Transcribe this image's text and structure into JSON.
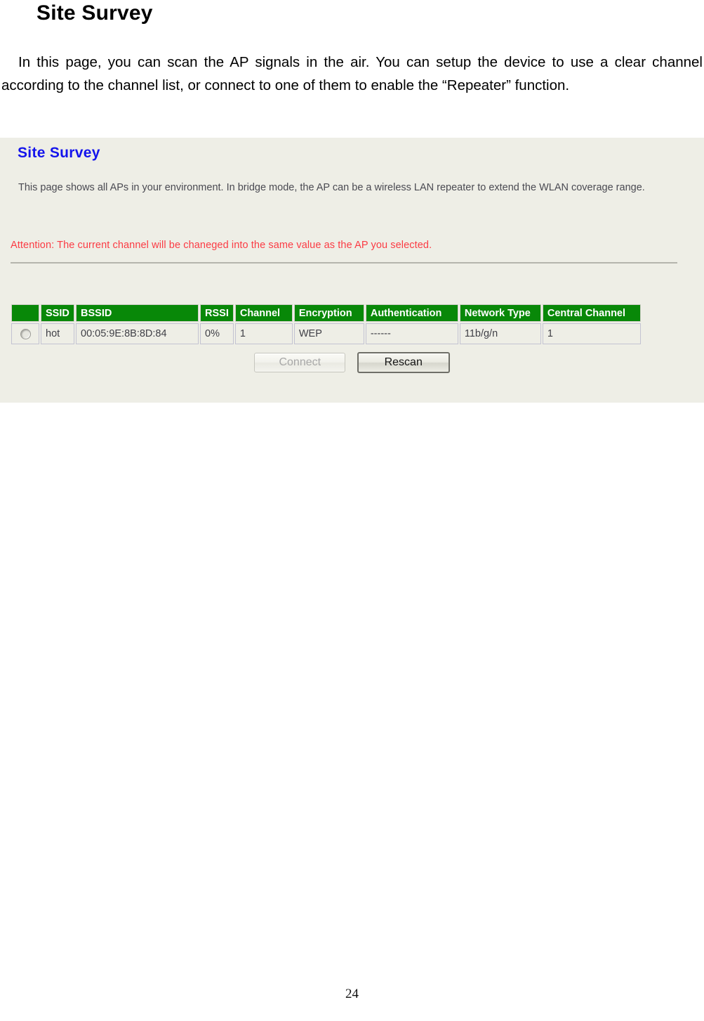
{
  "document": {
    "heading": "Site Survey",
    "paragraph": "In this page, you can scan the AP signals in the air. You can setup the device to use a clear channel according to the channel list, or connect to one of them to enable the “Repeater” function.",
    "page_number": "24"
  },
  "screenshot": {
    "title": "Site Survey",
    "description": "This page shows all APs in your environment. In bridge mode, the AP can be a wireless LAN repeater to extend the WLAN coverage range.",
    "attention": "Attention: The current channel will be chaneged into the same value as the AP you selected.",
    "colors": {
      "panel_background": "#EEEEE6",
      "title_blue": "#1414EC",
      "attention_red": "#FB3B44",
      "table_header_green": "#088808",
      "divider_gray": "#B5B5AD"
    },
    "table": {
      "headers": [
        "",
        "SSID",
        "BSSID",
        "RSSI",
        "Channel",
        "Encryption",
        "Authentication",
        "Network Type",
        "Central Channel"
      ],
      "rows": [
        {
          "selected": false,
          "ssid": "hot",
          "bssid": "00:05:9E:8B:8D:84",
          "rssi": "0%",
          "channel": "1",
          "encryption": "WEP",
          "authentication": "------",
          "network_type": "11b/g/n",
          "central_channel": "1"
        }
      ]
    },
    "buttons": {
      "connect": "Connect",
      "rescan": "Rescan"
    }
  }
}
